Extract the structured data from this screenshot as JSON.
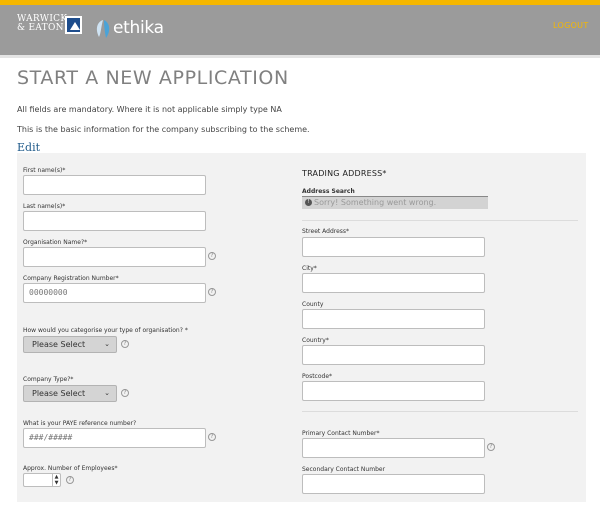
{
  "header": {
    "brand_we": "WARWICK\n& EATON",
    "brand_ethika": "ethika",
    "logout": "LOGOUT",
    "accent": "#f5b700",
    "bar_color": "#9b9b9b"
  },
  "page": {
    "title": "START A NEW APPLICATION",
    "note1": "All fields are mandatory. Where it is not applicable simply type NA",
    "note2": "This is the basic information for the company subscribing to the scheme.",
    "edit": "Edit"
  },
  "left": {
    "first_name": {
      "label": "First name(s)*",
      "value": ""
    },
    "last_name": {
      "label": "Last name(s)*",
      "value": ""
    },
    "org_name": {
      "label": "Organisation Name?*",
      "value": ""
    },
    "company_reg": {
      "label": "Company Registration Number*",
      "placeholder": "00000000"
    },
    "org_type": {
      "label": "How would you categorise your type of organisation? *",
      "selected": "Please Select"
    },
    "company_type": {
      "label": "Company Type?*",
      "selected": "Please Select"
    },
    "paye": {
      "label": "What is your PAYE reference number?",
      "placeholder": "###/#####"
    },
    "employees": {
      "label": "Approx. Number of Employees*",
      "value": ""
    }
  },
  "right": {
    "section_title": "TRADING ADDRESS*",
    "address_search": {
      "label": "Address Search",
      "message": "Sorry! Something went wrong."
    },
    "street": {
      "label": "Street Address*"
    },
    "city": {
      "label": "City*"
    },
    "county": {
      "label": "County"
    },
    "country": {
      "label": "Country*"
    },
    "postcode": {
      "label": "Postcode*"
    },
    "primary_phone": {
      "label": "Primary Contact Number*"
    },
    "secondary_phone": {
      "label": "Secondary Contact Number"
    }
  },
  "icons": {
    "help": "?",
    "chevron": "⌄",
    "warning": "!"
  }
}
